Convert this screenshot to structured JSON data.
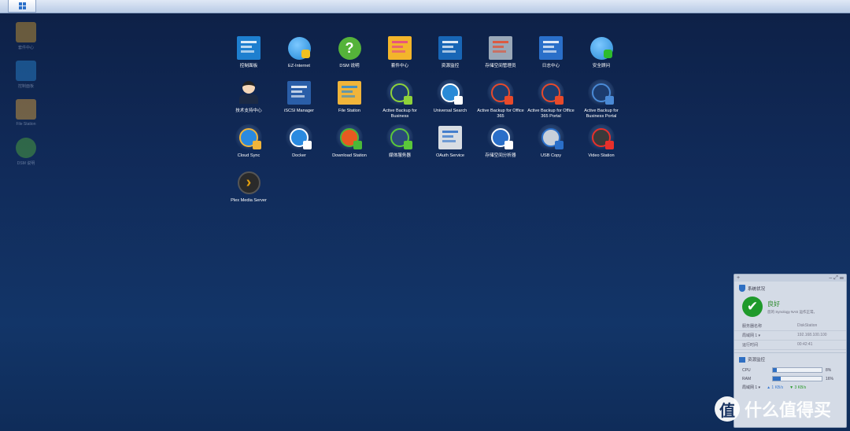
{
  "taskbar": {
    "main_menu_icon": "grid-icon"
  },
  "desktop": [
    {
      "label": "套件中心",
      "icon": "package-icon"
    },
    {
      "label": "控制面板",
      "icon": "control-panel-icon"
    },
    {
      "label": "File Station",
      "icon": "folder-icon"
    },
    {
      "label": "DSM 说明",
      "icon": "help-icon"
    }
  ],
  "apps": [
    {
      "label": "控制面板",
      "icon": "control-panel-icon",
      "bg": "#1e7fcf",
      "accent": "#ffffff"
    },
    {
      "label": "EZ-Internet",
      "icon": "ez-internet-icon",
      "bg": "#1f86d6",
      "accent": "#f0c020"
    },
    {
      "label": "DSM 说明",
      "icon": "help-icon",
      "bg": "#55b33a",
      "accent": "#ffffff"
    },
    {
      "label": "套件中心",
      "icon": "package-center-icon",
      "bg": "#f3b52b",
      "accent": "#e4458c"
    },
    {
      "label": "资源监控",
      "icon": "resource-monitor-icon",
      "bg": "#1866b6",
      "accent": "#ffffff"
    },
    {
      "label": "存储空间管理员",
      "icon": "storage-manager-icon",
      "bg": "#9aa8b8",
      "accent": "#e74c2b"
    },
    {
      "label": "日志中心",
      "icon": "log-center-icon",
      "bg": "#2a6fc9",
      "accent": "#ffffff"
    },
    {
      "label": "安全顾问",
      "icon": "security-advisor-icon",
      "bg": "#2a8ad6",
      "accent": "#2dbb2d"
    },
    {
      "label": "技术支持中心",
      "icon": "support-center-icon",
      "bg": "#f5d7b8",
      "accent": "#1c2a44"
    },
    {
      "label": "iSCSI Manager",
      "icon": "iscsi-icon",
      "bg": "#2a5ea8",
      "accent": "#ffffff"
    },
    {
      "label": "File Station",
      "icon": "file-station-icon",
      "bg": "#f0b43a",
      "accent": "#2a8ad6"
    },
    {
      "label": "Active Backup for Business",
      "icon": "active-backup-icon",
      "bg": "#1c3c6e",
      "accent": "#8ed23a"
    },
    {
      "label": "Universal Search",
      "icon": "universal-search-icon",
      "bg": "#2a8ad6",
      "accent": "#ffffff"
    },
    {
      "label": "Active Backup for Office 365",
      "icon": "active-backup-office-icon",
      "bg": "#1c3c6e",
      "accent": "#e84a2b"
    },
    {
      "label": "Active Backup for Office 365 Portal",
      "icon": "active-backup-portal-icon",
      "bg": "#1c3c6e",
      "accent": "#e84a2b"
    },
    {
      "label": "Active Backup for Business Portal",
      "icon": "active-backup-business-portal-icon",
      "bg": "#1c3c6e",
      "accent": "#4a8ad6"
    },
    {
      "label": "Cloud Sync",
      "icon": "cloud-sync-icon",
      "bg": "#2a8ae0",
      "accent": "#f0b43a"
    },
    {
      "label": "Docker",
      "icon": "docker-icon",
      "bg": "#2a8ae0",
      "accent": "#ffffff"
    },
    {
      "label": "Download Station",
      "icon": "download-station-icon",
      "bg": "#e85a20",
      "accent": "#4ab838"
    },
    {
      "label": "媒体服务器",
      "icon": "media-server-icon",
      "bg": "#2a4a7a",
      "accent": "#5ac83a"
    },
    {
      "label": "OAuth Service",
      "icon": "oauth-service-icon",
      "bg": "#d8dde3",
      "accent": "#2a6fc9"
    },
    {
      "label": "存储空间分析器",
      "icon": "storage-analyzer-icon",
      "bg": "#2a6fc9",
      "accent": "#ffffff"
    },
    {
      "label": "USB Copy",
      "icon": "usb-copy-icon",
      "bg": "#c8d0da",
      "accent": "#2a6fc9"
    },
    {
      "label": "Video Station",
      "icon": "video-station-icon",
      "bg": "#3a3a3a",
      "accent": "#e8302b"
    },
    {
      "label": "Plex Media Server",
      "icon": "plex-icon",
      "bg": "#2a2a2a",
      "accent": "#e5a00d"
    }
  ],
  "widget": {
    "system_status": {
      "title": "系统状况",
      "status": "良好",
      "description": "您的 Synology NAS 运作正常。",
      "rows": [
        {
          "label": "服务器名称",
          "value": "DiskStation"
        },
        {
          "label": "局域网 1 ▾",
          "value": "192.168.100.100"
        },
        {
          "label": "运行时间",
          "value": "00:42:41"
        }
      ]
    },
    "resource_monitor": {
      "title": "资源监控",
      "cpu": {
        "label": "CPU",
        "percent": 8,
        "text": "8%"
      },
      "ram": {
        "label": "RAM",
        "percent": 16,
        "text": "16%"
      },
      "network": {
        "label": "局域网 1 ▾",
        "up": "▲ 1 KB/s",
        "down": "▼ 3 KB/s"
      }
    }
  },
  "watermark": {
    "logo": "值",
    "text": "什么值得买"
  }
}
